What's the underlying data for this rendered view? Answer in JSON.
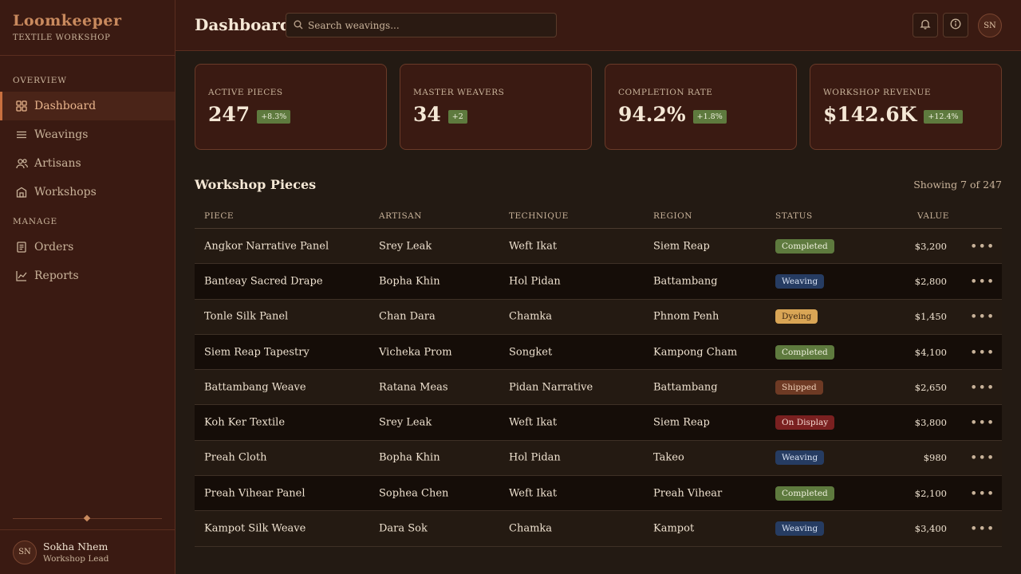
{
  "brand": {
    "title": "Loomkeeper",
    "subtitle": "TEXTILE WORKSHOP"
  },
  "sidebar": {
    "section_overview": "OVERVIEW",
    "section_manage": "MANAGE",
    "items": [
      {
        "label": "Dashboard",
        "icon": "grid-icon",
        "active": true
      },
      {
        "label": "Weavings",
        "icon": "lines-icon"
      },
      {
        "label": "Artisans",
        "icon": "users-icon"
      },
      {
        "label": "Workshops",
        "icon": "building-icon"
      },
      {
        "label": "Orders",
        "icon": "document-icon"
      },
      {
        "label": "Reports",
        "icon": "chart-line-icon"
      }
    ],
    "user": {
      "initials": "SN",
      "name": "Sokha Nhem",
      "role": "Workshop Lead"
    }
  },
  "header": {
    "title": "Dashboard",
    "search_placeholder": "Search weavings...",
    "avatar_initials": "SN"
  },
  "stats": [
    {
      "label": "ACTIVE PIECES",
      "value": "247",
      "delta": "+8.3%"
    },
    {
      "label": "MASTER WEAVERS",
      "value": "34",
      "delta": "+2"
    },
    {
      "label": "COMPLETION RATE",
      "value": "94.2%",
      "delta": "+1.8%"
    },
    {
      "label": "WORKSHOP REVENUE",
      "value": "$142.6K",
      "delta": "+12.4%"
    }
  ],
  "table": {
    "title": "Workshop Pieces",
    "showing": "Showing 7 of 247",
    "columns": [
      "PIECE",
      "ARTISAN",
      "TECHNIQUE",
      "REGION",
      "STATUS",
      "VALUE"
    ],
    "rows": [
      {
        "piece": "Angkor Narrative Panel",
        "artisan": "Srey Leak",
        "technique": "Weft Ikat",
        "region": "Siem Reap",
        "status": "Completed",
        "value": "$3,200"
      },
      {
        "piece": "Banteay Sacred Drape",
        "artisan": "Bopha Khin",
        "technique": "Hol Pidan",
        "region": "Battambang",
        "status": "Weaving",
        "value": "$2,800"
      },
      {
        "piece": "Tonle Silk Panel",
        "artisan": "Chan Dara",
        "technique": "Chamka",
        "region": "Phnom Penh",
        "status": "Dyeing",
        "value": "$1,450"
      },
      {
        "piece": "Siem Reap Tapestry",
        "artisan": "Vicheka Prom",
        "technique": "Songket",
        "region": "Kampong Cham",
        "status": "Completed",
        "value": "$4,100"
      },
      {
        "piece": "Battambang Weave",
        "artisan": "Ratana Meas",
        "technique": "Pidan Narrative",
        "region": "Battambang",
        "status": "Shipped",
        "value": "$2,650"
      },
      {
        "piece": "Koh Ker Textile",
        "artisan": "Srey Leak",
        "technique": "Weft Ikat",
        "region": "Siem Reap",
        "status": "On Display",
        "value": "$3,800"
      },
      {
        "piece": "Preah Cloth",
        "artisan": "Bopha Khin",
        "technique": "Hol Pidan",
        "region": "Takeo",
        "status": "Weaving",
        "value": "$980"
      },
      {
        "piece": "Preah Vihear Panel",
        "artisan": "Sophea Chen",
        "technique": "Weft Ikat",
        "region": "Preah Vihear",
        "status": "Completed",
        "value": "$2,100"
      },
      {
        "piece": "Kampot Silk Weave",
        "artisan": "Dara Sok",
        "technique": "Chamka",
        "region": "Kampot",
        "status": "Weaving",
        "value": "$3,400"
      }
    ],
    "more_glyph": "•••"
  },
  "status_colors": {
    "Completed": {
      "bg": "#5e7a3e",
      "fg": "#eef0dc"
    },
    "Weaving": {
      "bg": "#263c62",
      "fg": "#dbe4f5"
    },
    "Dyeing": {
      "bg": "#d9a555",
      "fg": "#3a2410"
    },
    "Shipped": {
      "bg": "#6e3a24",
      "fg": "#f0d0b8"
    },
    "On Display": {
      "bg": "#7a2020",
      "fg": "#f5d8d0"
    }
  }
}
